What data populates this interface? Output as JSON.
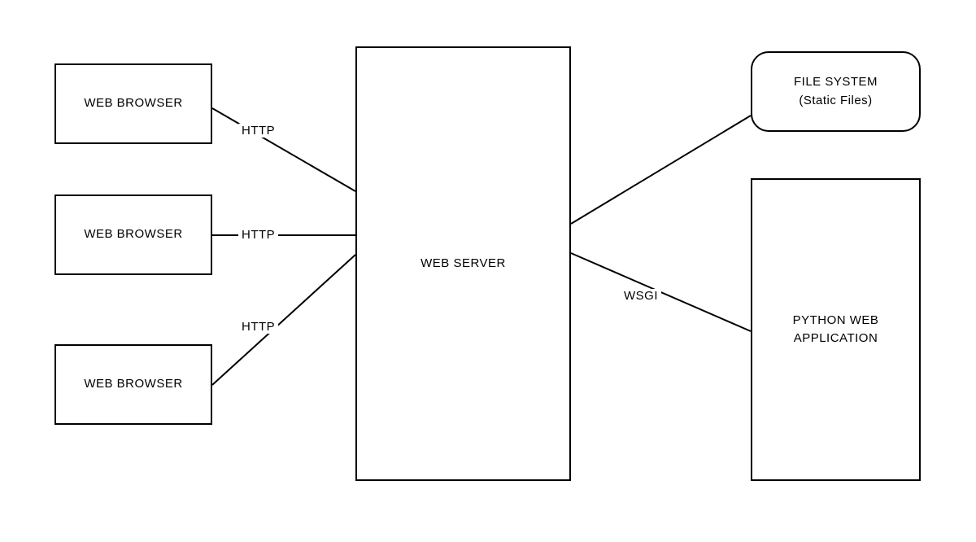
{
  "nodes": {
    "browser1": "WEB BROWSER",
    "browser2": "WEB BROWSER",
    "browser3": "WEB BROWSER",
    "webserver": "WEB SERVER",
    "filesystem_line1": "FILE SYSTEM",
    "filesystem_line2": "(Static Files)",
    "pythonapp_line1": "PYTHON WEB",
    "pythonapp_line2": "APPLICATION"
  },
  "edges": {
    "http1": "HTTP",
    "http2": "HTTP",
    "http3": "HTTP",
    "wsgi": "WSGI"
  }
}
